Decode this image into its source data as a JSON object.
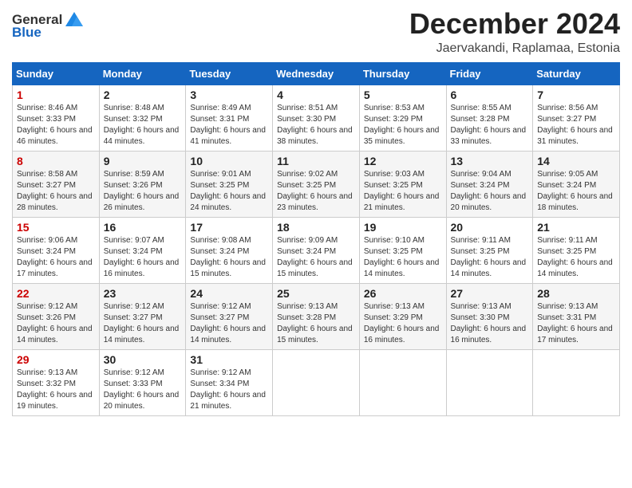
{
  "header": {
    "logo_general": "General",
    "logo_blue": "Blue",
    "month_title": "December 2024",
    "location": "Jaervakandi, Raplamaa, Estonia"
  },
  "days_of_week": [
    "Sunday",
    "Monday",
    "Tuesday",
    "Wednesday",
    "Thursday",
    "Friday",
    "Saturday"
  ],
  "weeks": [
    [
      {
        "day": "1",
        "sunrise": "Sunrise: 8:46 AM",
        "sunset": "Sunset: 3:33 PM",
        "daylight": "Daylight: 6 hours and 46 minutes."
      },
      {
        "day": "2",
        "sunrise": "Sunrise: 8:48 AM",
        "sunset": "Sunset: 3:32 PM",
        "daylight": "Daylight: 6 hours and 44 minutes."
      },
      {
        "day": "3",
        "sunrise": "Sunrise: 8:49 AM",
        "sunset": "Sunset: 3:31 PM",
        "daylight": "Daylight: 6 hours and 41 minutes."
      },
      {
        "day": "4",
        "sunrise": "Sunrise: 8:51 AM",
        "sunset": "Sunset: 3:30 PM",
        "daylight": "Daylight: 6 hours and 38 minutes."
      },
      {
        "day": "5",
        "sunrise": "Sunrise: 8:53 AM",
        "sunset": "Sunset: 3:29 PM",
        "daylight": "Daylight: 6 hours and 35 minutes."
      },
      {
        "day": "6",
        "sunrise": "Sunrise: 8:55 AM",
        "sunset": "Sunset: 3:28 PM",
        "daylight": "Daylight: 6 hours and 33 minutes."
      },
      {
        "day": "7",
        "sunrise": "Sunrise: 8:56 AM",
        "sunset": "Sunset: 3:27 PM",
        "daylight": "Daylight: 6 hours and 31 minutes."
      }
    ],
    [
      {
        "day": "8",
        "sunrise": "Sunrise: 8:58 AM",
        "sunset": "Sunset: 3:27 PM",
        "daylight": "Daylight: 6 hours and 28 minutes."
      },
      {
        "day": "9",
        "sunrise": "Sunrise: 8:59 AM",
        "sunset": "Sunset: 3:26 PM",
        "daylight": "Daylight: 6 hours and 26 minutes."
      },
      {
        "day": "10",
        "sunrise": "Sunrise: 9:01 AM",
        "sunset": "Sunset: 3:25 PM",
        "daylight": "Daylight: 6 hours and 24 minutes."
      },
      {
        "day": "11",
        "sunrise": "Sunrise: 9:02 AM",
        "sunset": "Sunset: 3:25 PM",
        "daylight": "Daylight: 6 hours and 23 minutes."
      },
      {
        "day": "12",
        "sunrise": "Sunrise: 9:03 AM",
        "sunset": "Sunset: 3:25 PM",
        "daylight": "Daylight: 6 hours and 21 minutes."
      },
      {
        "day": "13",
        "sunrise": "Sunrise: 9:04 AM",
        "sunset": "Sunset: 3:24 PM",
        "daylight": "Daylight: 6 hours and 20 minutes."
      },
      {
        "day": "14",
        "sunrise": "Sunrise: 9:05 AM",
        "sunset": "Sunset: 3:24 PM",
        "daylight": "Daylight: 6 hours and 18 minutes."
      }
    ],
    [
      {
        "day": "15",
        "sunrise": "Sunrise: 9:06 AM",
        "sunset": "Sunset: 3:24 PM",
        "daylight": "Daylight: 6 hours and 17 minutes."
      },
      {
        "day": "16",
        "sunrise": "Sunrise: 9:07 AM",
        "sunset": "Sunset: 3:24 PM",
        "daylight": "Daylight: 6 hours and 16 minutes."
      },
      {
        "day": "17",
        "sunrise": "Sunrise: 9:08 AM",
        "sunset": "Sunset: 3:24 PM",
        "daylight": "Daylight: 6 hours and 15 minutes."
      },
      {
        "day": "18",
        "sunrise": "Sunrise: 9:09 AM",
        "sunset": "Sunset: 3:24 PM",
        "daylight": "Daylight: 6 hours and 15 minutes."
      },
      {
        "day": "19",
        "sunrise": "Sunrise: 9:10 AM",
        "sunset": "Sunset: 3:25 PM",
        "daylight": "Daylight: 6 hours and 14 minutes."
      },
      {
        "day": "20",
        "sunrise": "Sunrise: 9:11 AM",
        "sunset": "Sunset: 3:25 PM",
        "daylight": "Daylight: 6 hours and 14 minutes."
      },
      {
        "day": "21",
        "sunrise": "Sunrise: 9:11 AM",
        "sunset": "Sunset: 3:25 PM",
        "daylight": "Daylight: 6 hours and 14 minutes."
      }
    ],
    [
      {
        "day": "22",
        "sunrise": "Sunrise: 9:12 AM",
        "sunset": "Sunset: 3:26 PM",
        "daylight": "Daylight: 6 hours and 14 minutes."
      },
      {
        "day": "23",
        "sunrise": "Sunrise: 9:12 AM",
        "sunset": "Sunset: 3:27 PM",
        "daylight": "Daylight: 6 hours and 14 minutes."
      },
      {
        "day": "24",
        "sunrise": "Sunrise: 9:12 AM",
        "sunset": "Sunset: 3:27 PM",
        "daylight": "Daylight: 6 hours and 14 minutes."
      },
      {
        "day": "25",
        "sunrise": "Sunrise: 9:13 AM",
        "sunset": "Sunset: 3:28 PM",
        "daylight": "Daylight: 6 hours and 15 minutes."
      },
      {
        "day": "26",
        "sunrise": "Sunrise: 9:13 AM",
        "sunset": "Sunset: 3:29 PM",
        "daylight": "Daylight: 6 hours and 16 minutes."
      },
      {
        "day": "27",
        "sunrise": "Sunrise: 9:13 AM",
        "sunset": "Sunset: 3:30 PM",
        "daylight": "Daylight: 6 hours and 16 minutes."
      },
      {
        "day": "28",
        "sunrise": "Sunrise: 9:13 AM",
        "sunset": "Sunset: 3:31 PM",
        "daylight": "Daylight: 6 hours and 17 minutes."
      }
    ],
    [
      {
        "day": "29",
        "sunrise": "Sunrise: 9:13 AM",
        "sunset": "Sunset: 3:32 PM",
        "daylight": "Daylight: 6 hours and 19 minutes."
      },
      {
        "day": "30",
        "sunrise": "Sunrise: 9:12 AM",
        "sunset": "Sunset: 3:33 PM",
        "daylight": "Daylight: 6 hours and 20 minutes."
      },
      {
        "day": "31",
        "sunrise": "Sunrise: 9:12 AM",
        "sunset": "Sunset: 3:34 PM",
        "daylight": "Daylight: 6 hours and 21 minutes."
      },
      null,
      null,
      null,
      null
    ]
  ]
}
